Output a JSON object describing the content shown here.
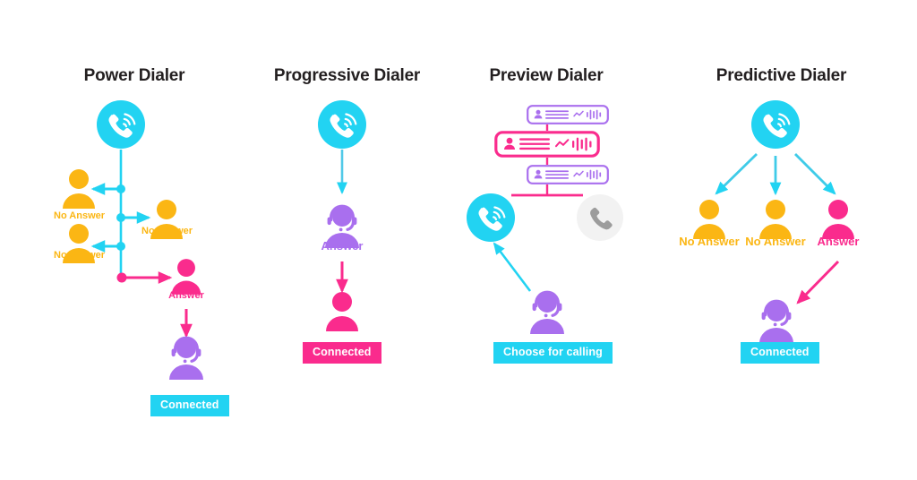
{
  "infographic": {
    "title_color": "#231f20",
    "background": "#ffffff",
    "palette": {
      "cyan": "#22d3f2",
      "pink": "#fa2b8d",
      "orange": "#fbb614",
      "purple": "#a96fee",
      "grey": "#f2f2f2",
      "grey_icon": "#9c9c9c"
    }
  },
  "columns": [
    {
      "id": "power",
      "title": "Power Dialer",
      "source_icon": "phone-ringing-icon",
      "outcomes": [
        {
          "label": "No Answer",
          "color": "orange",
          "icon": "person-icon"
        },
        {
          "label": "No Answer",
          "color": "orange",
          "icon": "person-icon"
        },
        {
          "label": "No Answer",
          "color": "orange",
          "icon": "person-icon"
        },
        {
          "label": "Answer",
          "color": "pink",
          "icon": "person-icon"
        }
      ],
      "agent_icon": "headset-agent-icon",
      "badge": {
        "text": "Connected",
        "style": "cyan"
      }
    },
    {
      "id": "progressive",
      "title": "Progressive Dialer",
      "source_icon": "phone-ringing-icon",
      "outcomes": [
        {
          "label": "Answer",
          "color": "purple",
          "icon": "headset-agent-icon"
        }
      ],
      "result_icon": "person-icon",
      "badge": {
        "text": "Connected",
        "style": "pink"
      }
    },
    {
      "id": "preview",
      "title": "Preview Dialer",
      "cards": [
        {
          "state": "inactive",
          "color": "purple"
        },
        {
          "state": "active",
          "color": "pink"
        },
        {
          "state": "inactive",
          "color": "purple"
        }
      ],
      "source_icon": "phone-ringing-icon",
      "idle_icon": "phone-handset-icon",
      "agent_icon": "headset-agent-icon",
      "badge": {
        "text": "Choose for calling",
        "style": "cyan"
      }
    },
    {
      "id": "predictive",
      "title": "Predictive Dialer",
      "source_icon": "phone-ringing-icon",
      "outcomes": [
        {
          "label": "No Answer",
          "color": "orange",
          "icon": "person-icon"
        },
        {
          "label": "No Answer",
          "color": "orange",
          "icon": "person-icon"
        },
        {
          "label": "Answer",
          "color": "pink",
          "icon": "person-icon"
        }
      ],
      "agent_icon": "headset-agent-icon",
      "badge": {
        "text": "Connected",
        "style": "cyan"
      }
    }
  ]
}
